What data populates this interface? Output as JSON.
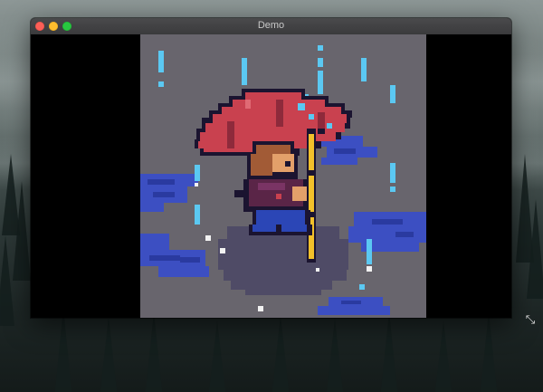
{
  "window": {
    "title": "Demo"
  },
  "icons": {
    "close": "close-button",
    "minimize": "minimize-button",
    "zoom": "zoom-button",
    "resize": "resize-icon"
  },
  "colors": {
    "canvas_bg": "#68656d",
    "umbrella": "#c9414f",
    "umbrella_dark": "#8e2a3b",
    "outline": "#1b1430",
    "rain": "#5bc8f2",
    "puddle": "#3c4fc2",
    "shadow": "#4f4b66",
    "pole": "#f2c02a",
    "skin": "#e3a06a",
    "hair": "#a25b36",
    "coat": "#5a2547",
    "pants": "#2b46b6"
  }
}
